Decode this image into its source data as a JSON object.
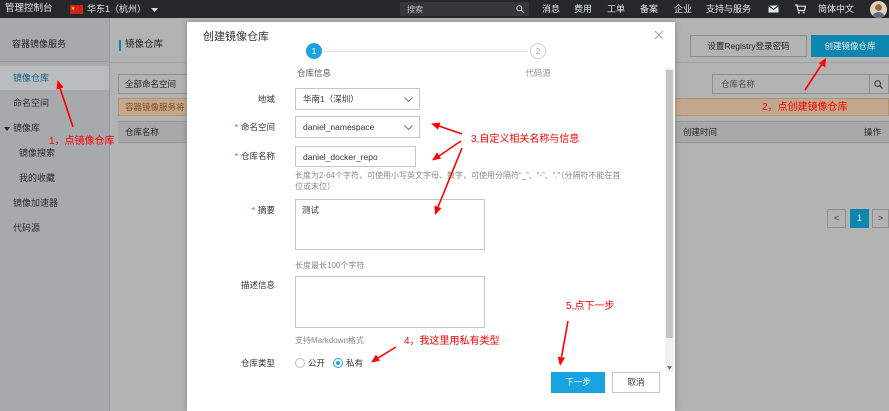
{
  "colors": {
    "accent": "#1aa3e1",
    "accent_dim": "#0d87b0",
    "annotation": "#ff0000",
    "required": "#e4393c",
    "topbar": "#25282b"
  },
  "icons": {
    "flag": "china-flag-icon",
    "search": "search-icon",
    "mail": "mail-icon",
    "cart": "cart-icon",
    "avatar": "avatar",
    "close": "close-icon",
    "chevron": "chevron-down-icon"
  },
  "topbar": {
    "console_label": "管理控制台",
    "region_label": "华东1（杭州）",
    "search_placeholder": "搜索",
    "nav": {
      "messages": "消息",
      "billing": "费用",
      "tickets": "工单",
      "icp": "备案",
      "enterprise": "企业",
      "support": "支持与服务"
    },
    "language": "简体中文"
  },
  "sidebar": {
    "title": "容器镜像服务",
    "active_index": 0,
    "items": [
      {
        "label": "镜像仓库"
      },
      {
        "label": "命名空间"
      },
      {
        "label": "镜像库"
      },
      {
        "label": "镜像搜索"
      },
      {
        "label": "我的收藏"
      },
      {
        "label": "镜像加速器"
      },
      {
        "label": "代码源"
      }
    ]
  },
  "main": {
    "title": "镜像仓库",
    "set_password_button": "设置Registry登录密码",
    "create_button": "创建镜像仓库",
    "namespace_filter": "全部命名空间",
    "search_placeholder": "仓库名称",
    "notice_text": "容器镜像服务将",
    "table": {
      "columns": [
        "仓库名称",
        "创建时间",
        "操作"
      ]
    },
    "pagination": {
      "prev": "<",
      "current": "1",
      "next": ">"
    }
  },
  "modal": {
    "title": "创建镜像仓库",
    "steps": [
      {
        "number": "1",
        "label": "仓库信息",
        "active": true
      },
      {
        "number": "2",
        "label": "代码源",
        "active": false
      }
    ],
    "form": {
      "region": {
        "label": "地域",
        "value": "华南1（深圳）",
        "required": false
      },
      "namespace": {
        "label": "命名空间",
        "value": "daniel_namespace",
        "required": true
      },
      "repo_name": {
        "label": "仓库名称",
        "value": "daniel_docker_repo",
        "required": true,
        "help": "长度为2-64个字符，可使用小写英文字母、数字，可使用分隔符“_”、“-”、“.”（分隔符不能在首位或末位）"
      },
      "summary": {
        "label": "摘要",
        "value": "测试",
        "required": true,
        "help": "长度最长100个字符"
      },
      "description": {
        "label": "描述信息",
        "value": "",
        "required": false,
        "help": "支持Markdown格式"
      },
      "repo_type": {
        "label": "仓库类型",
        "options": [
          "公开",
          "私有"
        ],
        "selected_index": 1
      }
    },
    "next_button": "下一步",
    "cancel_button": "取消"
  },
  "annotations": [
    {
      "text": "1，点镜像仓库"
    },
    {
      "text": "2，点创建镜像仓库"
    },
    {
      "text": "3,自定义相关名称与信息"
    },
    {
      "text": "4，我这里用私有类型"
    },
    {
      "text": "5,点下一步"
    }
  ]
}
